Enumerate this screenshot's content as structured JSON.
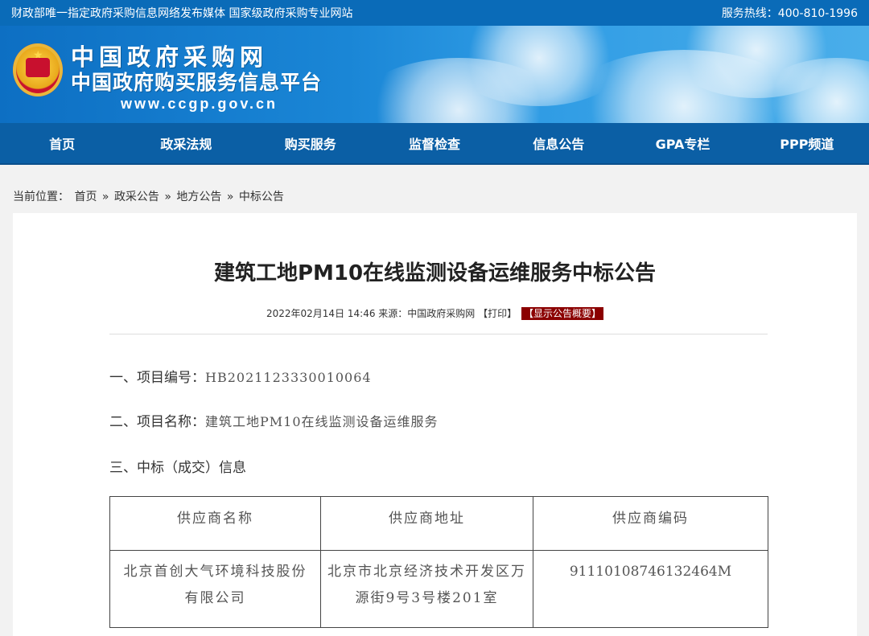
{
  "topbar": {
    "left": "财政部唯一指定政府采购信息网络发布媒体 国家级政府采购专业网站",
    "hotline": "服务热线：400-810-1996"
  },
  "brand": {
    "line1": "中国政府采购网",
    "line2": "中国政府购买服务信息平台",
    "url": "www.ccgp.gov.cn",
    "emblem": "national-emblem-icon"
  },
  "nav": [
    "首页",
    "政采法规",
    "购买服务",
    "监督检查",
    "信息公告",
    "GPA专栏",
    "PPP频道"
  ],
  "breadcrumb": {
    "prefix": "当前位置：",
    "items": [
      "首页",
      "政采公告",
      "地方公告",
      "中标公告"
    ],
    "separator": "»"
  },
  "article": {
    "title": "建筑工地PM10在线监测设备运维服务中标公告",
    "date": "2022年02月14日 14:46",
    "source": "来源：中国政府采购网",
    "print": "【打印】",
    "summary_tag": "【显示公告概要】",
    "project_no_label": "一、项目编号：",
    "project_no": "HB2021123330010064",
    "project_name_label": "二、项目名称：",
    "project_name": "建筑工地PM10在线监测设备运维服务",
    "section3": "三、中标（成交）信息"
  },
  "table": {
    "headers": [
      "供应商名称",
      "供应商地址",
      "供应商编码"
    ],
    "rows": [
      [
        "北京首创大气环境科技股份有限公司",
        "北京市北京经济技术开发区万源街9号3号楼201室",
        "91110108746132464M"
      ]
    ]
  },
  "colors": {
    "topbar": "#0a6bb8",
    "nav": "#0b5fa5",
    "tag": "#8b0000"
  }
}
